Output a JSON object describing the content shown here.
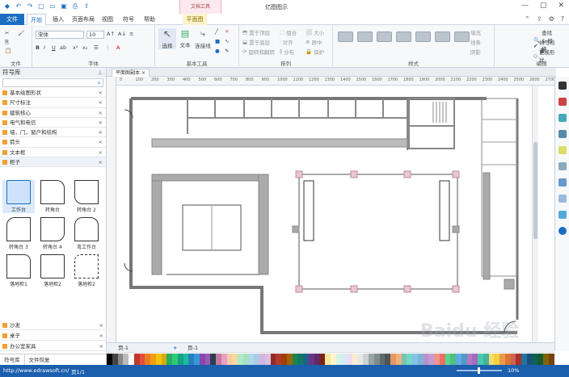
{
  "app": {
    "title": "亿图图示",
    "context_tab": "文档工具"
  },
  "menu": {
    "tabs": [
      "文件",
      "开始",
      "插入",
      "页面布局",
      "视图",
      "符号",
      "帮助",
      "平面图"
    ]
  },
  "ribbon": {
    "file_label": "文件",
    "font_name": "宋体",
    "font_size": "10",
    "groups": [
      "文件",
      "字体",
      "基本工具",
      "排列",
      "样式",
      "编辑"
    ],
    "tools": {
      "select": "选择",
      "text": "文本",
      "connector": "连接线",
      "arrange1": "置于顶层",
      "arrange2": "置于底层",
      "arrange3": "组合",
      "arrange4": "对齐",
      "arrange5": "分布",
      "arrange6": "保护",
      "arrange7": "旋转和翻转",
      "arrange8": "大小",
      "arrange9": "居中",
      "arrange10": "取消组合",
      "style1": "填充",
      "style2": "线条",
      "style3": "阴影",
      "edit1": "查找 & 替换",
      "edit2": "拼写检查",
      "edit3": "更换形状"
    }
  },
  "left_panel": {
    "title": "符号库",
    "search_placeholder": "",
    "libraries": [
      "基本绘图形状",
      "尺寸标注",
      "建筑核心",
      "电气和电信",
      "墙，门，窗户和结构",
      "箭头",
      "文本框",
      "柜子"
    ],
    "libraries_bottom": [
      "沙发",
      "桌子",
      "办公室家具"
    ],
    "shapes": [
      {
        "label": "工作台"
      },
      {
        "label": "转角台"
      },
      {
        "label": "转角台 2"
      },
      {
        "label": "转角台 3"
      },
      {
        "label": "转角台 4"
      },
      {
        "label": "弯工作台"
      },
      {
        "label": "落地柜1"
      },
      {
        "label": "落地柜2"
      },
      {
        "label": "落地柜2"
      }
    ],
    "bottom_tabs": [
      "符号库",
      "文件恢复"
    ]
  },
  "document": {
    "tab_label": "平面图副本",
    "ruler_ticks": [
      "0",
      "100",
      "200",
      "300",
      "400",
      "500",
      "600",
      "700",
      "800",
      "900",
      "1000",
      "1100",
      "1200",
      "1300",
      "1400",
      "1500",
      "1600",
      "1700",
      "1800",
      "1900",
      "2000",
      "2100",
      "2200",
      "2300",
      "2400",
      "2500",
      "2600",
      "2700"
    ]
  },
  "pages": {
    "page1": "页-1",
    "add": "+",
    "page1b": "页-1"
  },
  "status": {
    "url": "http://www.edrawsoft.cn/",
    "page": "页1/1",
    "zoom": "10%"
  },
  "watermark": "Baidu 经验",
  "colors": {
    "accent": "#1b6ec2",
    "status": "#1b5fae"
  }
}
